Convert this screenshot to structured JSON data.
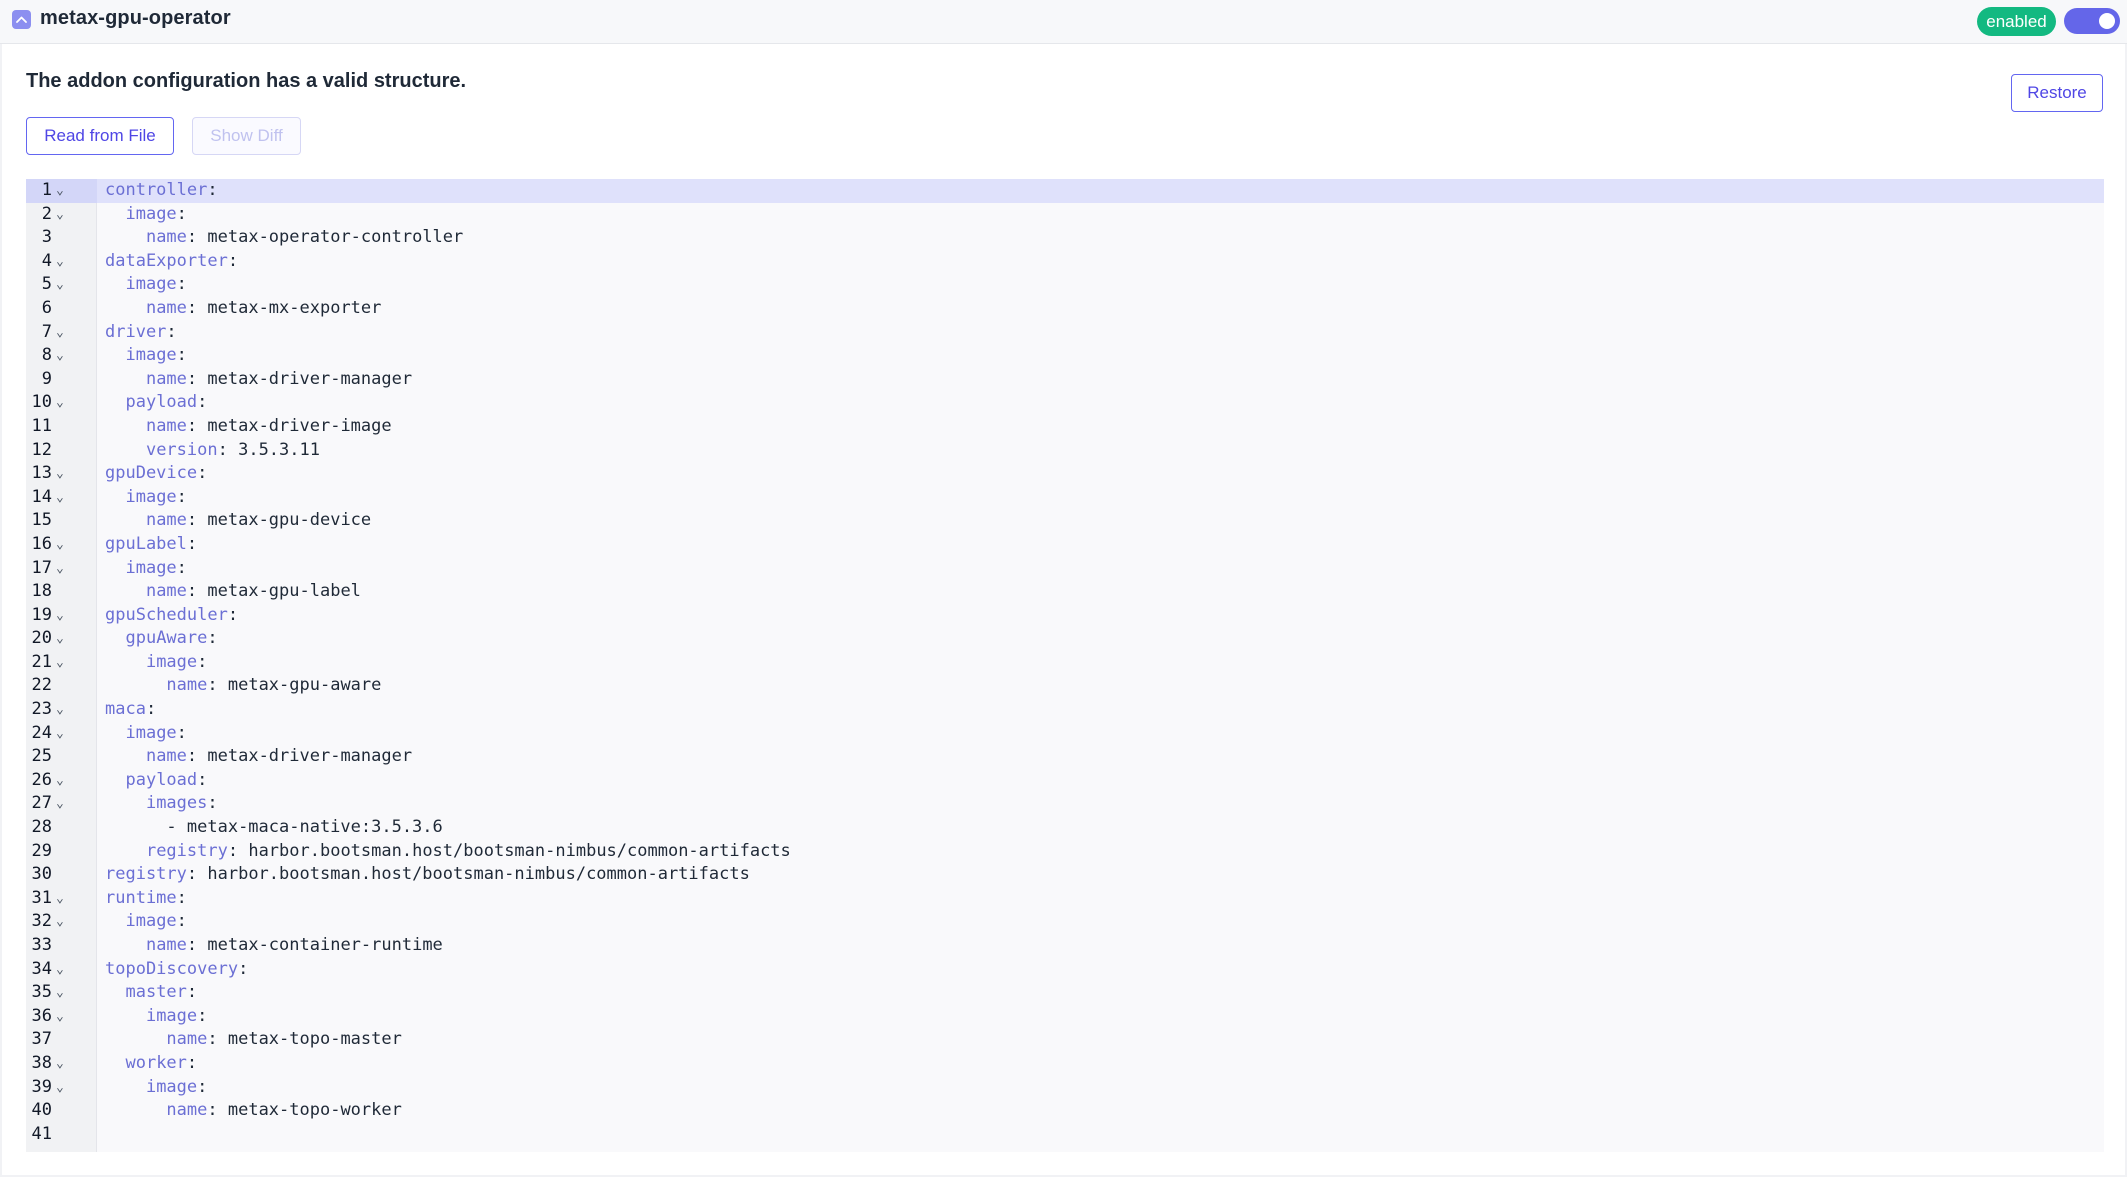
{
  "header": {
    "addon_name": "metax-gpu-operator",
    "status": "enabled",
    "collapse_icon": "chevron-up-icon",
    "toggle_on": true
  },
  "panel": {
    "validity_message": "The addon configuration has a valid structure.",
    "read_from_file_label": "Read from File",
    "show_diff_label": "Show Diff",
    "restore_label": "Restore"
  },
  "colors": {
    "accent": "#6366f1",
    "status_green": "#13b981",
    "yaml_key": "#6b6fd4"
  },
  "editor": {
    "active_line": 1,
    "lines": [
      {
        "n": "1",
        "indent": "",
        "key": "controller",
        "value": "",
        "fold": true
      },
      {
        "n": "2",
        "indent": "  ",
        "key": "image",
        "value": "",
        "fold": true
      },
      {
        "n": "3",
        "indent": "    ",
        "key": "name",
        "value": " metax-operator-controller",
        "fold": false
      },
      {
        "n": "4",
        "indent": "",
        "key": "dataExporter",
        "value": "",
        "fold": true
      },
      {
        "n": "5",
        "indent": "  ",
        "key": "image",
        "value": "",
        "fold": true
      },
      {
        "n": "6",
        "indent": "    ",
        "key": "name",
        "value": " metax-mx-exporter",
        "fold": false
      },
      {
        "n": "7",
        "indent": "",
        "key": "driver",
        "value": "",
        "fold": true
      },
      {
        "n": "8",
        "indent": "  ",
        "key": "image",
        "value": "",
        "fold": true
      },
      {
        "n": "9",
        "indent": "    ",
        "key": "name",
        "value": " metax-driver-manager",
        "fold": false
      },
      {
        "n": "10",
        "indent": "  ",
        "key": "payload",
        "value": "",
        "fold": true
      },
      {
        "n": "11",
        "indent": "    ",
        "key": "name",
        "value": " metax-driver-image",
        "fold": false
      },
      {
        "n": "12",
        "indent": "    ",
        "key": "version",
        "value": " 3.5.3.11",
        "fold": false
      },
      {
        "n": "13",
        "indent": "",
        "key": "gpuDevice",
        "value": "",
        "fold": true
      },
      {
        "n": "14",
        "indent": "  ",
        "key": "image",
        "value": "",
        "fold": true
      },
      {
        "n": "15",
        "indent": "    ",
        "key": "name",
        "value": " metax-gpu-device",
        "fold": false
      },
      {
        "n": "16",
        "indent": "",
        "key": "gpuLabel",
        "value": "",
        "fold": true
      },
      {
        "n": "17",
        "indent": "  ",
        "key": "image",
        "value": "",
        "fold": true
      },
      {
        "n": "18",
        "indent": "    ",
        "key": "name",
        "value": " metax-gpu-label",
        "fold": false
      },
      {
        "n": "19",
        "indent": "",
        "key": "gpuScheduler",
        "value": "",
        "fold": true
      },
      {
        "n": "20",
        "indent": "  ",
        "key": "gpuAware",
        "value": "",
        "fold": true
      },
      {
        "n": "21",
        "indent": "    ",
        "key": "image",
        "value": "",
        "fold": true
      },
      {
        "n": "22",
        "indent": "      ",
        "key": "name",
        "value": " metax-gpu-aware",
        "fold": false
      },
      {
        "n": "23",
        "indent": "",
        "key": "maca",
        "value": "",
        "fold": true
      },
      {
        "n": "24",
        "indent": "  ",
        "key": "image",
        "value": "",
        "fold": true
      },
      {
        "n": "25",
        "indent": "    ",
        "key": "name",
        "value": " metax-driver-manager",
        "fold": false
      },
      {
        "n": "26",
        "indent": "  ",
        "key": "payload",
        "value": "",
        "fold": true
      },
      {
        "n": "27",
        "indent": "    ",
        "key": "images",
        "value": "",
        "fold": true
      },
      {
        "n": "28",
        "indent": "      ",
        "key": "",
        "value": "- metax-maca-native:3.5.3.6",
        "fold": false
      },
      {
        "n": "29",
        "indent": "    ",
        "key": "registry",
        "value": " harbor.bootsman.host/bootsman-nimbus/common-artifacts",
        "fold": false
      },
      {
        "n": "30",
        "indent": "",
        "key": "registry",
        "value": " harbor.bootsman.host/bootsman-nimbus/common-artifacts",
        "fold": false
      },
      {
        "n": "31",
        "indent": "",
        "key": "runtime",
        "value": "",
        "fold": true
      },
      {
        "n": "32",
        "indent": "  ",
        "key": "image",
        "value": "",
        "fold": true
      },
      {
        "n": "33",
        "indent": "    ",
        "key": "name",
        "value": " metax-container-runtime",
        "fold": false
      },
      {
        "n": "34",
        "indent": "",
        "key": "topoDiscovery",
        "value": "",
        "fold": true
      },
      {
        "n": "35",
        "indent": "  ",
        "key": "master",
        "value": "",
        "fold": true
      },
      {
        "n": "36",
        "indent": "    ",
        "key": "image",
        "value": "",
        "fold": true
      },
      {
        "n": "37",
        "indent": "      ",
        "key": "name",
        "value": " metax-topo-master",
        "fold": false
      },
      {
        "n": "38",
        "indent": "  ",
        "key": "worker",
        "value": "",
        "fold": true
      },
      {
        "n": "39",
        "indent": "    ",
        "key": "image",
        "value": "",
        "fold": true
      },
      {
        "n": "40",
        "indent": "      ",
        "key": "name",
        "value": " metax-topo-worker",
        "fold": false
      },
      {
        "n": "41",
        "indent": "",
        "key": "",
        "value": "",
        "fold": false
      }
    ]
  }
}
